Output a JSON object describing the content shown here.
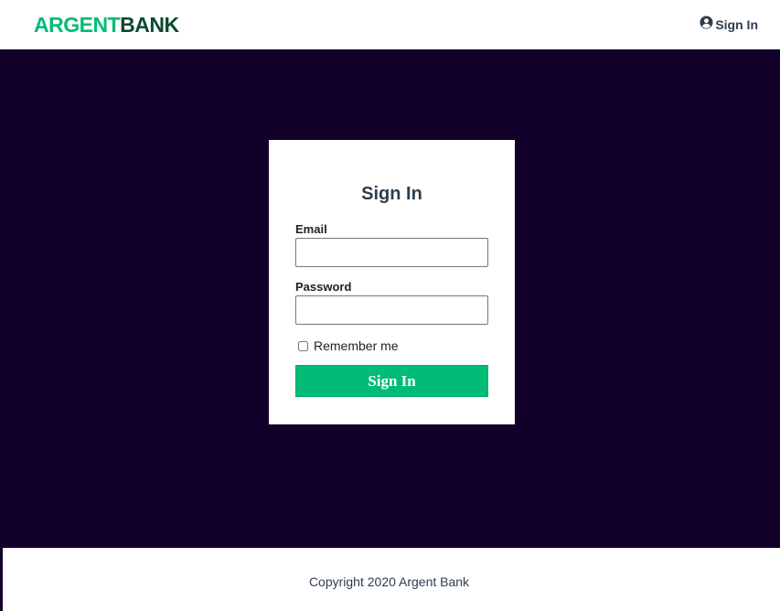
{
  "header": {
    "logo_part1": "ARGENT",
    "logo_part2": "BANK",
    "signin_link": "Sign In",
    "signin_icon": "user-circle-icon"
  },
  "login": {
    "title": "Sign In",
    "email_label": "Email",
    "email_value": "",
    "password_label": "Password",
    "password_value": "",
    "remember_label": "Remember me",
    "remember_checked": false,
    "submit_label": "Sign In"
  },
  "footer": {
    "copyright": "Copyright 2020 Argent Bank"
  },
  "colors": {
    "brand_green": "#00bc77",
    "background_dark": "#12002b",
    "text_dark": "#2c3e50"
  }
}
